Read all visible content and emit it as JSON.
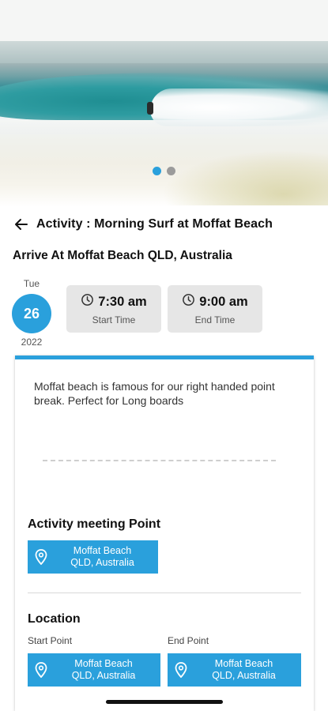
{
  "carousel": {
    "slides": 2,
    "active_index": 0
  },
  "header": {
    "title": "Activity : Morning Surf at Moffat Beach",
    "back_icon": "arrow-left-icon"
  },
  "subtitle": "Arrive At Moffat Beach QLD, Australia",
  "date": {
    "weekday": "Tue",
    "day": "26",
    "year": "2022"
  },
  "start_time": {
    "value": "7:30 am",
    "label": "Start Time",
    "icon": "clock-icon"
  },
  "end_time": {
    "value": "9:00 am",
    "label": "End Time",
    "icon": "clock-icon"
  },
  "card": {
    "description": "Moffat beach is famous for our right handed point break. Perfect for Long boards",
    "meeting_point": {
      "title": "Activity meeting Point",
      "location_line1": "Moffat Beach",
      "location_line2": "QLD, Australia"
    },
    "location": {
      "title": "Location",
      "start_label": "Start Point",
      "end_label": "End Point",
      "start_line1": "Moffat Beach",
      "start_line2": "QLD, Australia",
      "end_line1": "Moffat Beach",
      "end_line2": "QLD, Australia"
    }
  },
  "colors": {
    "accent": "#2aa0dc",
    "time_box": "#e6e6e6"
  }
}
